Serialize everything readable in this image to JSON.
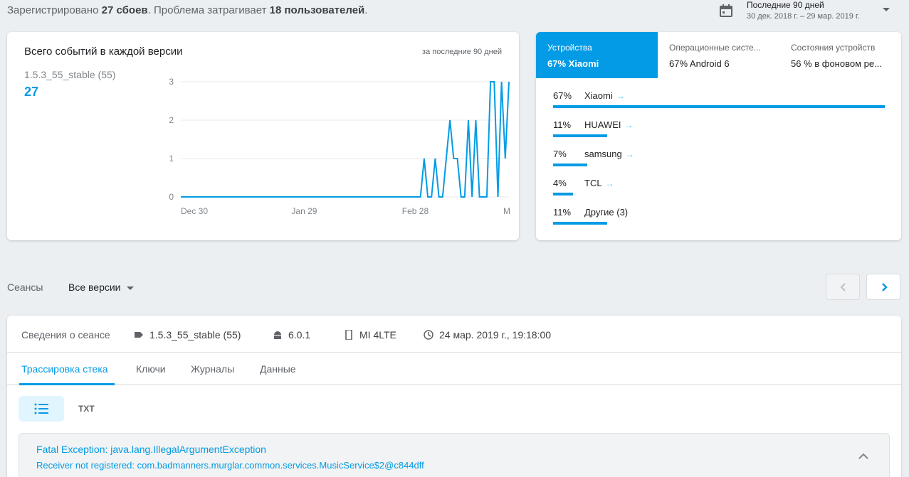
{
  "summary": {
    "prefix": "Зарегистрировано ",
    "crashes": "27 сбоев",
    "middle": ". Проблема затрагивает ",
    "users": "18 пользователей",
    "suffix": "."
  },
  "date_picker": {
    "title": "Последние 90 дней",
    "range": "30 дек. 2018 г. – 29 мар. 2019 г.",
    "icon": "calendar-icon"
  },
  "chart_card": {
    "title": "Всего событий в каждой версии",
    "period": "за последние 90 дней",
    "version_label": "1.5.3_55_stable (55)",
    "version_count": "27"
  },
  "chart_data": {
    "type": "line",
    "xlabels": [
      "Dec 30",
      "Jan 29",
      "Feb 28",
      "M"
    ],
    "yticks": [
      0,
      1,
      2,
      3
    ],
    "ylim": [
      0,
      3
    ],
    "days": 90,
    "values": [
      0,
      0,
      0,
      0,
      0,
      0,
      0,
      0,
      0,
      0,
      0,
      0,
      0,
      0,
      0,
      0,
      0,
      0,
      0,
      0,
      0,
      0,
      0,
      0,
      0,
      0,
      0,
      0,
      0,
      0,
      0,
      0,
      0,
      0,
      0,
      0,
      0,
      0,
      0,
      0,
      0,
      0,
      0,
      0,
      0,
      0,
      0,
      0,
      0,
      0,
      0,
      0,
      0,
      0,
      0,
      0,
      0,
      0,
      0,
      0,
      0,
      0,
      0,
      0,
      0,
      0,
      1,
      0,
      0,
      1,
      0,
      0,
      1,
      2,
      1,
      1,
      0,
      0,
      2,
      0,
      2,
      0,
      0,
      0,
      3,
      3,
      0,
      3,
      1,
      3
    ],
    "color": "#039be5"
  },
  "devices_card": {
    "tabs": [
      {
        "label": "Устройства",
        "value": "67% Xiaomi"
      },
      {
        "label": "Операционные систе...",
        "value": "67% Android 6"
      },
      {
        "label": "Состояния устройств",
        "value": "56 % в фоновом ре..."
      }
    ],
    "rows": [
      {
        "pct": "67%",
        "name": "Xiaomi",
        "fraction": 1.0,
        "arrow": "→"
      },
      {
        "pct": "11%",
        "name": "HUAWEI",
        "fraction": 0.164,
        "arrow": "→"
      },
      {
        "pct": "7%",
        "name": "samsung",
        "fraction": 0.104,
        "arrow": "→"
      },
      {
        "pct": "4%",
        "name": "TCL",
        "fraction": 0.06,
        "arrow": "→"
      },
      {
        "pct": "11%",
        "name": "Другие (3)",
        "fraction": 0.164,
        "arrow": ""
      }
    ]
  },
  "sessions": {
    "label": "Сеансы",
    "versions_select": "Все версии"
  },
  "session_card": {
    "info_label": "Сведения о сеансе",
    "version": "1.5.3_55_stable (55)",
    "os": "6.0.1",
    "device": "MI 4LTE",
    "time": "24 мар. 2019 г., 19:18:00",
    "tabs": [
      "Трассировка стека",
      "Ключи",
      "Журналы",
      "Данные"
    ],
    "txt_label": "TXT",
    "exception_title": "Fatal Exception: java.lang.IllegalArgumentException",
    "exception_message": "Receiver not registered: com.badmanners.murglar.common.services.MusicService$2@c844dff"
  },
  "colors": {
    "accent": "#039be5",
    "background": "#eceff1"
  }
}
